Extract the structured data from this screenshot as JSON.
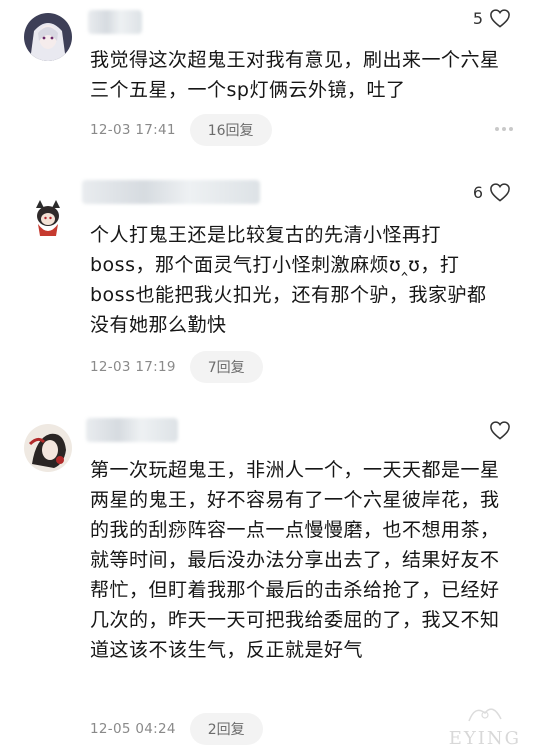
{
  "comments": [
    {
      "likes": "5",
      "text": "我觉得这次超鬼王对我有意见，刷出来一个六星三个五星，一个sp灯俩云外镜，吐了",
      "time": "12-03 17:41",
      "replies": "16回复"
    },
    {
      "likes": "6",
      "text": "个人打鬼王还是比较复古的先清小怪再打boss，那个面灵气打小怪刺激麻烦ʊ‸ʊ，打boss也能把我火扣光，还有那个驴，我家驴都没有她那么勤快",
      "time": "12-03 17:19",
      "replies": "7回复"
    },
    {
      "likes": "",
      "text": "第一次玩超鬼王，非洲人一个，一天天都是一星两星的鬼王，好不容易有了一个六星彼岸花，我的我的刮痧阵容一点一点慢慢磨，也不想用茶，就等时间，最后没办法分享出去了，结果好友不帮忙，但盯着我那个最后的击杀给抢了，已经好几次的，昨天一天可把我给委屈的了，我又不知道这该不该生气，反正就是好气",
      "time": "12-05 04:24",
      "replies": "2回复"
    }
  ],
  "icons": {
    "like": "heart-outline-icon",
    "more": "more-dots-icon"
  },
  "watermark": "EYING",
  "colors": {
    "text": "#161616",
    "meta": "#8a8a8a",
    "reply_bg": "#f3f3f3"
  }
}
